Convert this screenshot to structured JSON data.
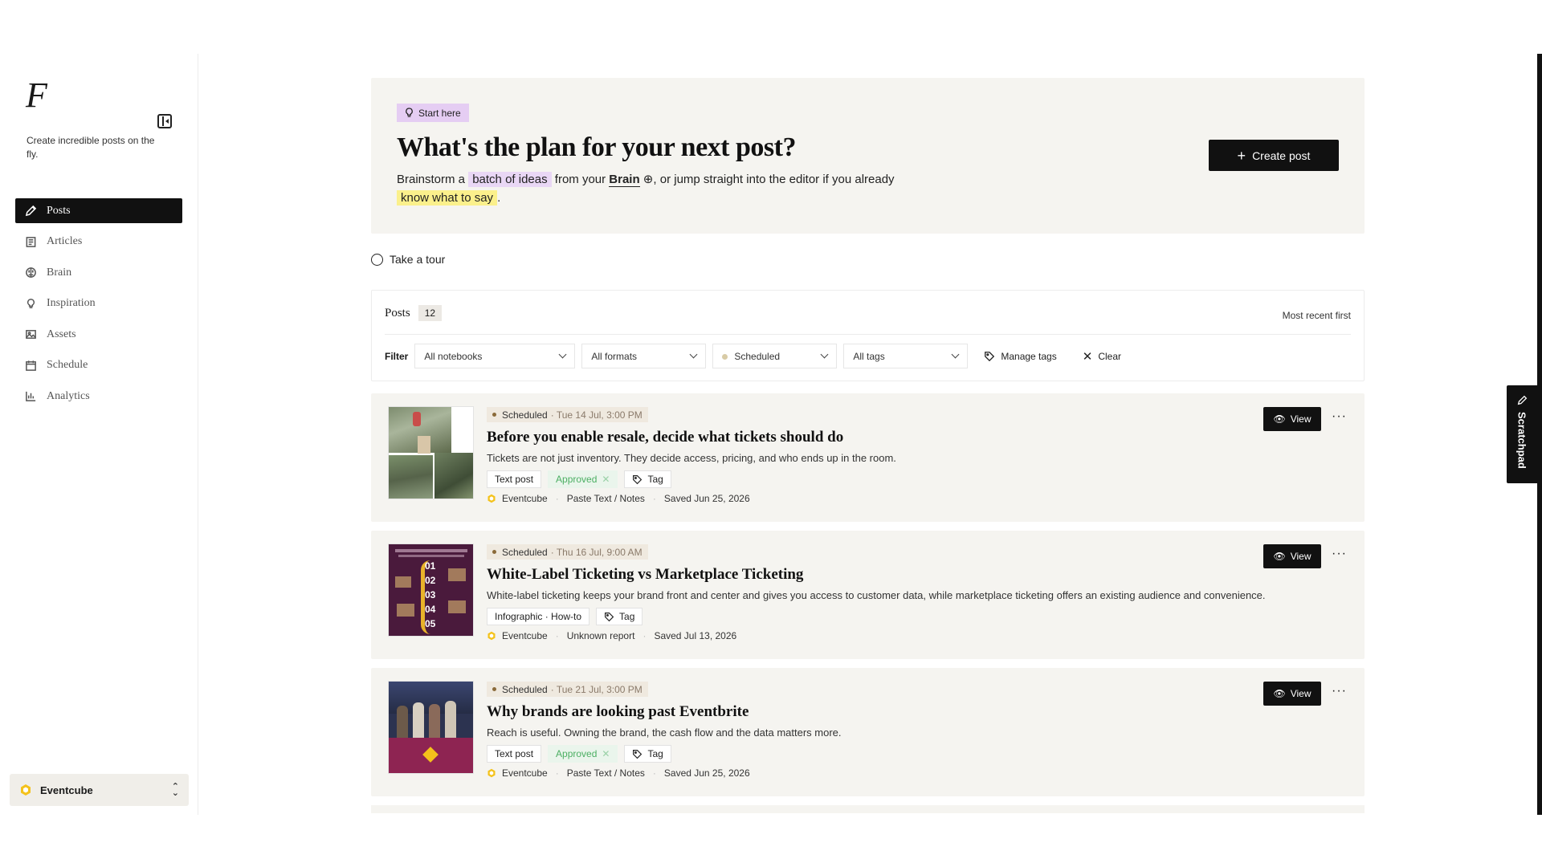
{
  "sidebar": {
    "logo": "F",
    "tagline": "Create incredible posts on the fly.",
    "items": [
      {
        "label": "Posts",
        "icon": "pencil-icon",
        "active": true
      },
      {
        "label": "Articles",
        "icon": "document-icon"
      },
      {
        "label": "Brain",
        "icon": "brain-icon"
      },
      {
        "label": "Inspiration",
        "icon": "lightbulb-icon"
      },
      {
        "label": "Assets",
        "icon": "image-icon"
      },
      {
        "label": "Schedule",
        "icon": "calendar-icon"
      },
      {
        "label": "Analytics",
        "icon": "bar-chart-icon"
      }
    ],
    "workspace": "Eventcube"
  },
  "hero": {
    "badge": "Start here",
    "title": "What's the plan for your next post?",
    "sub_1": "Brainstorm a ",
    "sub_hl1": "batch of ideas",
    "sub_2": " from your ",
    "sub_brain": "Brain",
    "sub_3": ", or jump straight into the editor if you already ",
    "sub_hl2": "know what to say",
    "sub_4": ".",
    "create_label": "Create post"
  },
  "tour": "Take a tour",
  "posts_panel": {
    "title": "Posts",
    "count": "12",
    "sort": "Most recent first",
    "filter_label": "Filter",
    "notebooks": "All notebooks",
    "formats": "All formats",
    "status": "Scheduled",
    "tags": "All tags",
    "manage_tags": "Manage tags",
    "clear": "Clear"
  },
  "cards": [
    {
      "status": "Scheduled",
      "time": "· Tue 14 Jul, 3:00 PM",
      "title": "Before you enable resale, decide what tickets should do",
      "desc": "Tickets are not just inventory. They decide access, pricing, and who ends up in the room.",
      "format": "Text post",
      "approval": "Approved",
      "tag": "Tag",
      "brand": "Eventcube",
      "source": "Paste Text / Notes",
      "saved": "Saved Jun 25, 2026"
    },
    {
      "status": "Scheduled",
      "time": "· Thu 16 Jul, 9:00 AM",
      "title": "White-Label Ticketing vs Marketplace Ticketing",
      "desc": "White-label ticketing keeps your brand front and center and gives you access to customer data, while marketplace ticketing offers an existing audience and convenience.",
      "format": "Infographic · How-to",
      "tag": "Tag",
      "brand": "Eventcube",
      "source": "Unknown report",
      "saved": "Saved Jul 13, 2026"
    },
    {
      "status": "Scheduled",
      "time": "· Tue 21 Jul, 3:00 PM",
      "title": "Why brands are looking past Eventbrite",
      "desc": "Reach is useful. Owning the brand, the cash flow and the data matters more.",
      "format": "Text post",
      "approval": "Approved",
      "tag": "Tag",
      "brand": "Eventcube",
      "source": "Paste Text / Notes",
      "saved": "Saved Jun 25, 2026"
    }
  ],
  "infographic_steps": [
    "01",
    "02",
    "03",
    "04",
    "05"
  ],
  "view_label": "View",
  "scratchpad": "Scratchpad",
  "colors": {
    "accent": "#111111",
    "hero_bg": "#f5f4f0",
    "highlight_purple": "#e9d7f5",
    "highlight_yellow": "#fbf08c",
    "approved_green": "#4caf63",
    "brand_yellow": "#f4c21b"
  }
}
